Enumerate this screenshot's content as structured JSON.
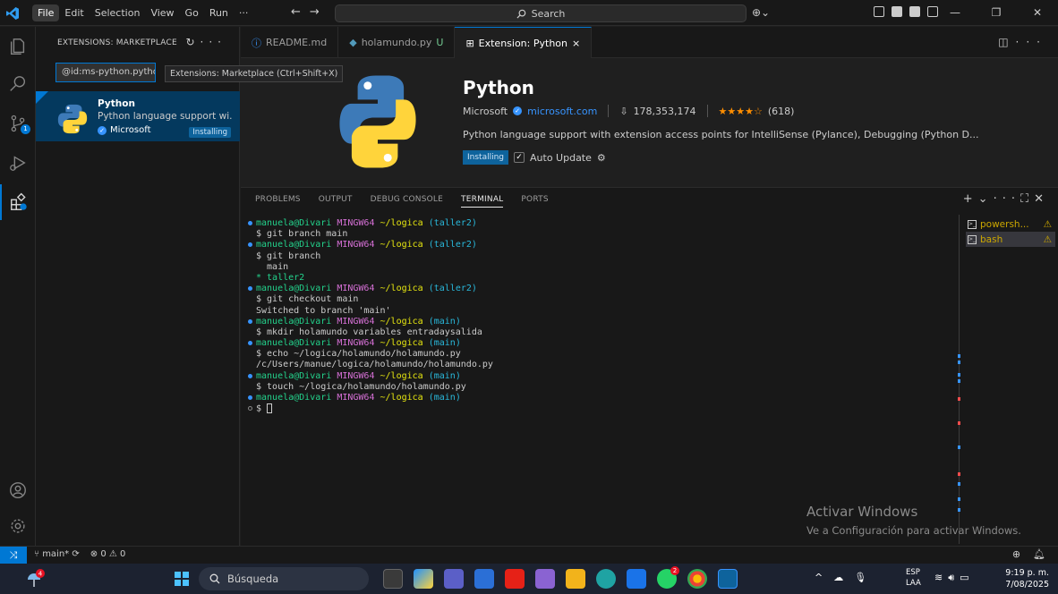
{
  "titlebar": {
    "menu": [
      "File",
      "Edit",
      "Selection",
      "View",
      "Go",
      "Run",
      "···"
    ],
    "search_label": "Search",
    "copilot_label": "⊕⌄"
  },
  "activity": {
    "items": [
      "explorer",
      "search",
      "source-control",
      "run-debug",
      "extensions"
    ],
    "source_control_badge": "1"
  },
  "sidebar": {
    "header": "EXTENSIONS: MARKETPLACE",
    "search_value": "@id:ms-python.python",
    "tooltip": "Extensions: Marketplace (Ctrl+Shift+X)",
    "ext": {
      "name": "Python",
      "description": "Python language support wi...",
      "publisher": "Microsoft",
      "status": "Installing"
    }
  },
  "tabs": [
    {
      "label": "README.md",
      "icon": "info-icon"
    },
    {
      "label": "holamundo.py",
      "suffix": "U",
      "icon": "python-file-icon"
    },
    {
      "label": "Extension: Python",
      "icon": "extension-icon",
      "close": "×"
    }
  ],
  "detail": {
    "title": "Python",
    "publisher": "Microsoft",
    "domain": "microsoft.com",
    "installs": "178,353,174",
    "stars": "★★★★☆",
    "rating_count": "(618)",
    "description": "Python language support with extension access points for IntelliSense (Pylance), Debugging (Python D...",
    "status": "Installing",
    "auto_update": "Auto Update"
  },
  "panel": {
    "tabs": [
      "PROBLEMS",
      "OUTPUT",
      "DEBUG CONSOLE",
      "TERMINAL",
      "PORTS"
    ],
    "active_tab": "TERMINAL",
    "terminals": [
      {
        "label": "powersh...",
        "warn": "⚠"
      },
      {
        "label": "bash",
        "warn": "⚠"
      }
    ],
    "prompt": {
      "user": "manuela@Divari",
      "env": "MINGW64",
      "path": "~/logica"
    },
    "lines": [
      {
        "kind": "prompt",
        "branch": "(taller2)"
      },
      {
        "kind": "cmd",
        "text": "$ git branch main"
      },
      {
        "kind": "prompt",
        "branch": "(taller2)"
      },
      {
        "kind": "cmd",
        "text": "$ git branch"
      },
      {
        "kind": "out",
        "text": "  main"
      },
      {
        "kind": "outgreen",
        "text": "* taller2"
      },
      {
        "kind": "prompt",
        "branch": "(taller2)"
      },
      {
        "kind": "cmd",
        "text": "$ git checkout main"
      },
      {
        "kind": "out",
        "text": "Switched to branch 'main'"
      },
      {
        "kind": "prompt",
        "branch": "(main)"
      },
      {
        "kind": "cmd",
        "text": "$ mkdir holamundo variables entradaysalida"
      },
      {
        "kind": "prompt",
        "branch": "(main)"
      },
      {
        "kind": "cmd",
        "text": "$ echo ~/logica/holamundo/holamundo.py"
      },
      {
        "kind": "out",
        "text": "/c/Users/manue/logica/holamundo/holamundo.py"
      },
      {
        "kind": "prompt",
        "branch": "(main)"
      },
      {
        "kind": "cmd",
        "text": "$ touch ~/logica/holamundo/holamundo.py"
      },
      {
        "kind": "prompt",
        "branch": "(main)"
      },
      {
        "kind": "input",
        "text": "$ "
      }
    ]
  },
  "watermark": {
    "line1": "Activar Windows",
    "line2": "Ve a Configuración para activar Windows."
  },
  "statusbar": {
    "branch": "main*",
    "sync": "⊗ 0 ⚠ 0",
    "problems_errors": "0",
    "problems_warnings": "0"
  },
  "taskbar": {
    "search_placeholder": "Búsqueda",
    "weather_badge": "4",
    "whatsapp_badge": "2",
    "lang_line1": "ESP",
    "lang_line2": "LAA",
    "time": "9:19 p. m.",
    "date": "7/08/2025"
  }
}
